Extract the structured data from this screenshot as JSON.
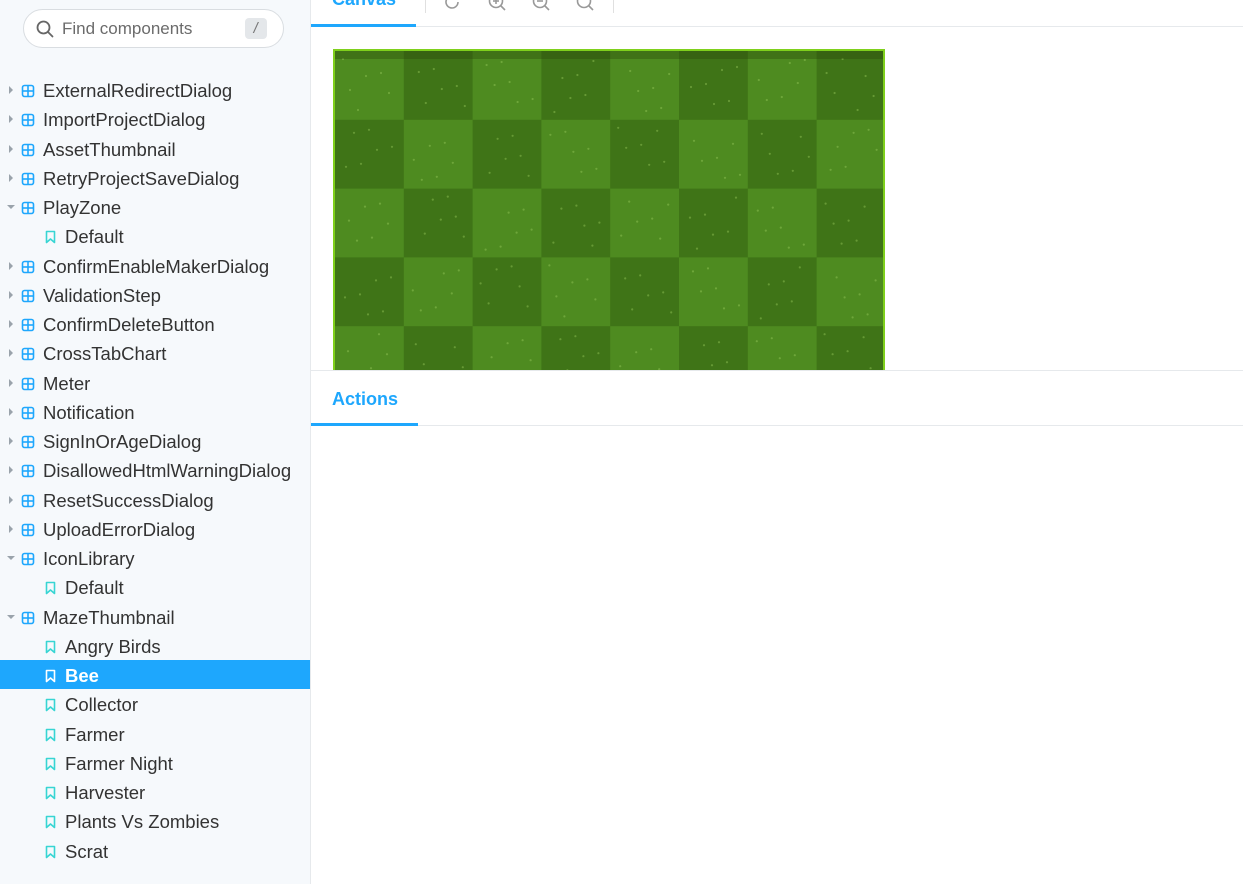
{
  "search": {
    "placeholder": "Find components",
    "shortcut": "/"
  },
  "tree": [
    {
      "kind": "component",
      "label": "ExternalRedirectDialog",
      "expanded": false
    },
    {
      "kind": "component",
      "label": "ImportProjectDialog",
      "expanded": false
    },
    {
      "kind": "component",
      "label": "AssetThumbnail",
      "expanded": false
    },
    {
      "kind": "component",
      "label": "RetryProjectSaveDialog",
      "expanded": false
    },
    {
      "kind": "component",
      "label": "PlayZone",
      "expanded": true
    },
    {
      "kind": "story",
      "label": "Default"
    },
    {
      "kind": "component",
      "label": "ConfirmEnableMakerDialog",
      "expanded": false
    },
    {
      "kind": "component",
      "label": "ValidationStep",
      "expanded": false
    },
    {
      "kind": "component",
      "label": "ConfirmDeleteButton",
      "expanded": false
    },
    {
      "kind": "component",
      "label": "CrossTabChart",
      "expanded": false
    },
    {
      "kind": "component",
      "label": "Meter",
      "expanded": false
    },
    {
      "kind": "component",
      "label": "Notification",
      "expanded": false
    },
    {
      "kind": "component",
      "label": "SignInOrAgeDialog",
      "expanded": false
    },
    {
      "kind": "component",
      "label": "DisallowedHtmlWarningDialog",
      "expanded": false
    },
    {
      "kind": "component",
      "label": "ResetSuccessDialog",
      "expanded": false
    },
    {
      "kind": "component",
      "label": "UploadErrorDialog",
      "expanded": false
    },
    {
      "kind": "component",
      "label": "IconLibrary",
      "expanded": true
    },
    {
      "kind": "story",
      "label": "Default"
    },
    {
      "kind": "component",
      "label": "MazeThumbnail",
      "expanded": true
    },
    {
      "kind": "story",
      "label": "Angry Birds"
    },
    {
      "kind": "story",
      "label": "Bee",
      "selected": true
    },
    {
      "kind": "story",
      "label": "Collector"
    },
    {
      "kind": "story",
      "label": "Farmer"
    },
    {
      "kind": "story",
      "label": "Farmer Night"
    },
    {
      "kind": "story",
      "label": "Harvester"
    },
    {
      "kind": "story",
      "label": "Plants Vs Zombies"
    },
    {
      "kind": "story",
      "label": "Scrat"
    }
  ],
  "toolbar": {
    "canvas_tab": "Canvas",
    "icons": [
      "reload-icon",
      "zoom-in-icon",
      "zoom-out-icon",
      "zoom-reset-icon"
    ]
  },
  "panel": {
    "actions_tab": "Actions"
  },
  "colors": {
    "accent": "#1ea7fd",
    "sidebar_bg": "#f6f9fc",
    "component_icon": "#1ea7fd",
    "story_icon": "#37d5d3",
    "grass_light": "#4e8b20",
    "grass_dark": "#3f7417"
  }
}
